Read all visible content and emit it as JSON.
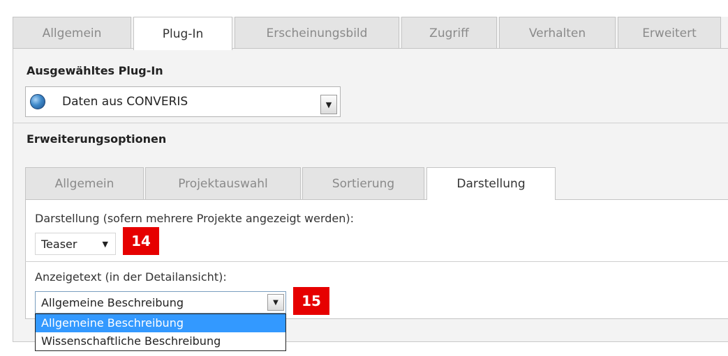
{
  "top_tabs": [
    {
      "label": "Allgemein"
    },
    {
      "label": "Plug-In"
    },
    {
      "label": "Erscheinungsbild"
    },
    {
      "label": "Zugriff"
    },
    {
      "label": "Verhalten"
    },
    {
      "label": "Erweitert"
    }
  ],
  "plugin": {
    "section_label": "Ausgewähltes Plug-In",
    "selected": "Daten aus CONVERIS",
    "icon": "globe-icon"
  },
  "extension": {
    "section_label": "Erweiterungsoptionen",
    "tabs": [
      {
        "label": "Allgemein"
      },
      {
        "label": "Projektauswahl"
      },
      {
        "label": "Sortierung"
      },
      {
        "label": "Darstellung"
      }
    ],
    "darstellung": {
      "label": "Darstellung (sofern mehrere Projekte angezeigt werden):",
      "value": "Teaser",
      "badge": "14"
    },
    "anzeigetext": {
      "label": "Anzeigetext (in der Detailansicht):",
      "value": "Allgemeine Beschreibung",
      "badge": "15",
      "options": [
        "Allgemeine Beschreibung",
        "Wissenschaftliche Beschreibung"
      ],
      "highlighted_option": "Allgemeine Beschreibung"
    }
  },
  "colors": {
    "badge": "#e60000",
    "selection": "#3399ff"
  }
}
